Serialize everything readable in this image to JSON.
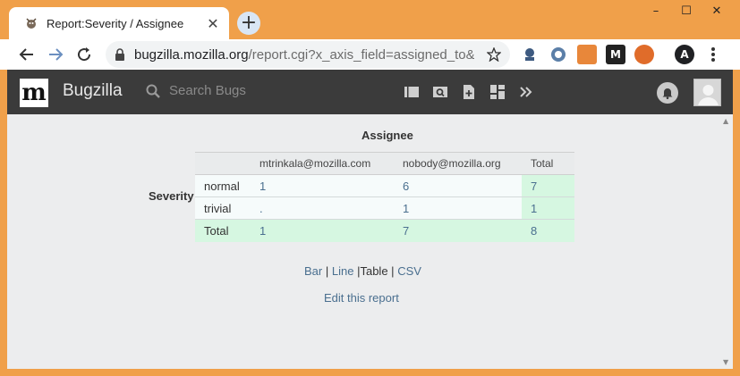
{
  "browser": {
    "tab_title": "Report:Severity / Assignee",
    "tab_close": "✕",
    "new_tab": "+",
    "url_domain": "bugzilla.mozilla.org",
    "url_path": "/report.cgi?x_axis_field=assigned_to&y_...",
    "window_controls": [
      "–",
      "☐",
      "✕"
    ],
    "profile_initial": "A",
    "extensions": [
      "extension-1",
      "extension-2",
      "extension-3",
      "extension-4",
      "extension-5"
    ]
  },
  "bugzilla": {
    "logo_letter": "m",
    "app_name": "Bugzilla",
    "search_placeholder": "Search Bugs"
  },
  "report": {
    "col_axis_label": "Assignee",
    "row_axis_label": "Severity",
    "columns": [
      "mtrinkala@mozilla.com",
      "nobody@mozilla.org",
      "Total"
    ],
    "rows": [
      {
        "name": "normal",
        "values": [
          "1",
          "6",
          "7"
        ]
      },
      {
        "name": "trivial",
        "values": [
          ".",
          "1",
          "1"
        ]
      }
    ],
    "totals": {
      "name": "Total",
      "values": [
        "1",
        "7",
        "8"
      ]
    },
    "formats": {
      "bar": "Bar",
      "line": "Line",
      "table": "Table",
      "csv": "CSV",
      "sep": "|"
    },
    "edit_link": "Edit this report"
  },
  "colors": {
    "titlebar": "#f0a04a",
    "header": "#3b3b3b",
    "page_bg": "#ecedee",
    "total_bg": "#d6f7e1",
    "link": "#4a6f8f"
  }
}
